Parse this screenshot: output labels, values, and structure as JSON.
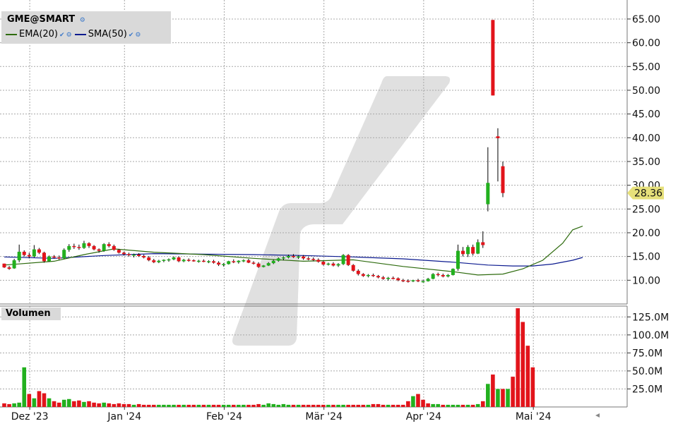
{
  "legend": {
    "symbol": "GME@SMART",
    "ema_label": "EMA(20)",
    "sma_label": "SMA(50)",
    "ema_color": "#2e6b0e",
    "sma_color": "#0b1a8f"
  },
  "volume_panel": {
    "label": "Volumen"
  },
  "colors": {
    "up": "#22b01e",
    "down": "#e2141b",
    "grid": "#a8a8a8",
    "last_price_bg": "#e6e07a"
  },
  "chart_data": [
    {
      "type": "candlestick",
      "title": "GME@SMART",
      "y_ticks": [
        "65.00",
        "60.00",
        "55.00",
        "50.00",
        "45.00",
        "40.00",
        "35.00",
        "30.00",
        "25.00",
        "20.00",
        "15.00",
        "10.00"
      ],
      "ylim": [
        5.0,
        69.0
      ],
      "last_price": "28.36",
      "x_labels": [
        "Dez '23",
        "Jan '24",
        "Feb '24",
        "Mär '24",
        "Apr '24",
        "Mai '24"
      ],
      "x_label_index": [
        2,
        21,
        41,
        61,
        81,
        103
      ],
      "grid": true,
      "candles": [
        [
          13.5,
          13.5,
          12.6,
          12.7
        ],
        [
          12.7,
          13.0,
          12.2,
          12.4
        ],
        [
          12.5,
          14.5,
          12.4,
          14.2
        ],
        [
          14.2,
          17.5,
          13.8,
          16.0
        ],
        [
          16.0,
          16.3,
          15.0,
          15.3
        ],
        [
          15.3,
          15.8,
          14.6,
          15.0
        ],
        [
          15.0,
          17.4,
          14.8,
          16.5
        ],
        [
          16.5,
          16.8,
          15.5,
          15.8
        ],
        [
          15.8,
          16.0,
          13.7,
          14.0
        ],
        [
          14.0,
          15.2,
          13.9,
          15.0
        ],
        [
          15.0,
          15.3,
          14.6,
          14.8
        ],
        [
          14.8,
          15.2,
          14.3,
          14.6
        ],
        [
          14.6,
          16.7,
          14.5,
          16.4
        ],
        [
          16.4,
          17.6,
          16.0,
          17.2
        ],
        [
          17.2,
          17.7,
          16.6,
          17.0
        ],
        [
          17.0,
          17.5,
          16.4,
          16.8
        ],
        [
          16.8,
          18.3,
          16.6,
          17.8
        ],
        [
          17.8,
          18.0,
          16.8,
          17.2
        ],
        [
          17.2,
          17.4,
          16.3,
          16.5
        ],
        [
          16.5,
          16.7,
          15.8,
          16.2
        ],
        [
          16.2,
          17.8,
          16.0,
          17.6
        ],
        [
          17.6,
          18.0,
          16.9,
          17.2
        ],
        [
          17.2,
          17.5,
          16.2,
          16.4
        ],
        [
          16.4,
          16.6,
          15.6,
          15.8
        ],
        [
          15.8,
          16.0,
          15.2,
          15.5
        ],
        [
          15.5,
          15.8,
          15.0,
          15.3
        ],
        [
          15.3,
          15.6,
          14.8,
          15.4
        ],
        [
          15.4,
          15.7,
          14.9,
          15.1
        ],
        [
          15.1,
          15.4,
          14.6,
          14.8
        ],
        [
          14.8,
          15.1,
          14.0,
          14.2
        ],
        [
          14.2,
          14.5,
          13.6,
          13.8
        ],
        [
          13.8,
          14.3,
          13.6,
          14.1
        ],
        [
          14.1,
          14.4,
          13.8,
          14.3
        ],
        [
          14.3,
          14.6,
          13.9,
          14.4
        ],
        [
          14.4,
          15.0,
          14.2,
          14.8
        ],
        [
          14.8,
          15.0,
          13.8,
          14.0
        ],
        [
          14.0,
          14.5,
          13.8,
          14.3
        ],
        [
          14.3,
          14.6,
          13.9,
          14.2
        ],
        [
          14.2,
          14.4,
          13.9,
          14.0
        ],
        [
          14.0,
          14.3,
          13.7,
          14.1
        ],
        [
          14.1,
          14.4,
          13.8,
          13.9
        ],
        [
          13.9,
          14.2,
          13.6,
          14.0
        ],
        [
          14.0,
          14.3,
          13.5,
          13.7
        ],
        [
          13.7,
          14.0,
          13.0,
          13.3
        ],
        [
          13.3,
          13.6,
          12.9,
          13.4
        ],
        [
          13.4,
          14.1,
          13.3,
          14.0
        ],
        [
          14.0,
          14.4,
          13.6,
          13.8
        ],
        [
          13.8,
          14.2,
          13.5,
          14.1
        ],
        [
          14.1,
          14.4,
          13.8,
          14.2
        ],
        [
          14.2,
          14.5,
          13.6,
          13.7
        ],
        [
          13.7,
          14.0,
          13.3,
          13.5
        ],
        [
          13.5,
          13.8,
          12.6,
          12.8
        ],
        [
          12.8,
          13.2,
          12.7,
          13.1
        ],
        [
          13.1,
          13.8,
          13.0,
          13.6
        ],
        [
          13.6,
          14.3,
          13.4,
          14.1
        ],
        [
          14.1,
          14.8,
          13.9,
          14.6
        ],
        [
          14.6,
          15.0,
          14.2,
          14.8
        ],
        [
          14.8,
          15.4,
          14.6,
          15.1
        ],
        [
          15.1,
          15.5,
          14.7,
          14.9
        ],
        [
          14.9,
          15.2,
          14.5,
          15.0
        ],
        [
          15.0,
          15.3,
          14.3,
          14.6
        ],
        [
          14.6,
          14.9,
          14.2,
          14.5
        ],
        [
          14.5,
          14.8,
          14.0,
          14.3
        ],
        [
          14.3,
          14.6,
          13.7,
          13.9
        ],
        [
          13.9,
          14.1,
          13.1,
          13.3
        ],
        [
          13.3,
          13.7,
          13.1,
          13.5
        ],
        [
          13.5,
          13.8,
          12.9,
          13.1
        ],
        [
          13.1,
          13.6,
          12.8,
          13.4
        ],
        [
          13.4,
          15.5,
          13.2,
          15.3
        ],
        [
          15.3,
          15.5,
          13.0,
          13.2
        ],
        [
          13.2,
          13.4,
          11.8,
          12.0
        ],
        [
          12.0,
          12.3,
          11.0,
          11.3
        ],
        [
          11.3,
          11.5,
          10.7,
          10.9
        ],
        [
          10.9,
          11.3,
          10.6,
          11.1
        ],
        [
          11.1,
          11.4,
          10.7,
          10.9
        ],
        [
          10.9,
          11.1,
          10.4,
          10.6
        ],
        [
          10.6,
          10.9,
          10.1,
          10.3
        ],
        [
          10.3,
          10.7,
          9.9,
          10.5
        ],
        [
          10.5,
          10.8,
          10.2,
          10.4
        ],
        [
          10.4,
          10.6,
          9.8,
          10.0
        ],
        [
          10.0,
          10.3,
          9.6,
          9.9
        ],
        [
          9.9,
          10.2,
          9.5,
          9.8
        ],
        [
          9.8,
          10.1,
          9.6,
          10.0
        ],
        [
          10.0,
          10.3,
          9.6,
          9.8
        ],
        [
          9.8,
          10.1,
          9.5,
          9.8
        ],
        [
          9.8,
          10.5,
          9.7,
          10.3
        ],
        [
          10.3,
          11.5,
          10.2,
          11.3
        ],
        [
          11.3,
          11.6,
          10.8,
          11.1
        ],
        [
          11.1,
          11.4,
          10.6,
          10.8
        ],
        [
          10.8,
          11.3,
          10.6,
          11.1
        ],
        [
          11.1,
          12.5,
          11.0,
          12.4
        ],
        [
          12.4,
          17.5,
          12.0,
          16.2
        ],
        [
          16.2,
          17.0,
          15.0,
          15.5
        ],
        [
          15.5,
          17.4,
          14.9,
          17.0
        ],
        [
          17.0,
          17.5,
          15.2,
          15.6
        ],
        [
          15.6,
          18.6,
          15.5,
          18.0
        ],
        [
          18.0,
          20.3,
          16.8,
          17.4
        ],
        [
          26.0,
          38.0,
          24.5,
          30.5
        ],
        [
          64.8,
          64.8,
          48.9,
          48.9
        ],
        [
          40.3,
          42.0,
          30.8,
          39.9
        ],
        [
          34.0,
          35.0,
          27.5,
          28.36
        ]
      ],
      "ema20": [
        [
          0,
          13.2
        ],
        [
          10,
          14.0
        ],
        [
          16,
          15.4
        ],
        [
          22,
          16.6
        ],
        [
          30,
          15.9
        ],
        [
          40,
          15.4
        ],
        [
          50,
          14.6
        ],
        [
          60,
          14.0
        ],
        [
          70,
          14.3
        ],
        [
          80,
          12.9
        ],
        [
          90,
          11.8
        ],
        [
          95,
          11.1
        ],
        [
          100,
          11.3
        ],
        [
          104,
          12.4
        ],
        [
          108,
          14.2
        ],
        [
          112,
          17.8
        ],
        [
          114,
          20.6
        ],
        [
          116,
          21.4
        ]
      ],
      "sma50": [
        [
          0,
          14.9
        ],
        [
          10,
          14.6
        ],
        [
          20,
          15.2
        ],
        [
          30,
          15.6
        ],
        [
          40,
          15.5
        ],
        [
          50,
          15.4
        ],
        [
          60,
          15.2
        ],
        [
          70,
          14.9
        ],
        [
          80,
          14.5
        ],
        [
          90,
          13.8
        ],
        [
          97,
          13.2
        ],
        [
          102,
          13.0
        ],
        [
          106,
          13.0
        ],
        [
          110,
          13.4
        ],
        [
          114,
          14.2
        ],
        [
          116,
          14.8
        ]
      ]
    },
    {
      "type": "bar",
      "title": "Volumen",
      "y_ticks": [
        "125.0M",
        "100.0M",
        "75.0M",
        "50.0M",
        "25.0M"
      ],
      "ylim": [
        0,
        140
      ],
      "unit": "M",
      "values": [
        5,
        4,
        5,
        6,
        55,
        18,
        12,
        22,
        19,
        12,
        8,
        6,
        10,
        11,
        8,
        9,
        7,
        8,
        6,
        5,
        6,
        5,
        4,
        5,
        4,
        4,
        3,
        4,
        3,
        3,
        3,
        3,
        3,
        3,
        3,
        3,
        3,
        3,
        3,
        3,
        3,
        3,
        3,
        3,
        3,
        3,
        3,
        3,
        3,
        3,
        3,
        4,
        3,
        5,
        4,
        3,
        4,
        3,
        3,
        3,
        3,
        3,
        3,
        3,
        3,
        3,
        3,
        3,
        3,
        3,
        3,
        3,
        3,
        3,
        4,
        4,
        3,
        3,
        3,
        3,
        3,
        8,
        15,
        18,
        10,
        5,
        4,
        4,
        3,
        3,
        3,
        3,
        3,
        3,
        3,
        4,
        8,
        32,
        45,
        25,
        25,
        25,
        42,
        137,
        118,
        85,
        55
      ],
      "up": [
        0,
        0,
        1,
        1,
        1,
        0,
        1,
        0,
        0,
        1,
        0,
        0,
        1,
        1,
        0,
        0,
        1,
        0,
        0,
        0,
        1,
        0,
        0,
        0,
        0,
        0,
        1,
        0,
        0,
        0,
        0,
        1,
        1,
        1,
        1,
        0,
        1,
        0,
        0,
        1,
        0,
        1,
        0,
        0,
        1,
        1,
        0,
        1,
        1,
        0,
        0,
        0,
        1,
        1,
        1,
        1,
        1,
        1,
        0,
        1,
        0,
        0,
        0,
        0,
        0,
        1,
        0,
        1,
        1,
        0,
        0,
        0,
        0,
        1,
        0,
        0,
        0,
        1,
        0,
        0,
        0,
        0,
        1,
        0,
        0,
        0,
        1,
        1,
        0,
        1,
        1,
        1,
        0,
        1,
        0,
        1,
        0,
        1,
        0,
        1,
        0,
        1,
        0,
        0,
        0,
        0,
        0
      ]
    }
  ]
}
